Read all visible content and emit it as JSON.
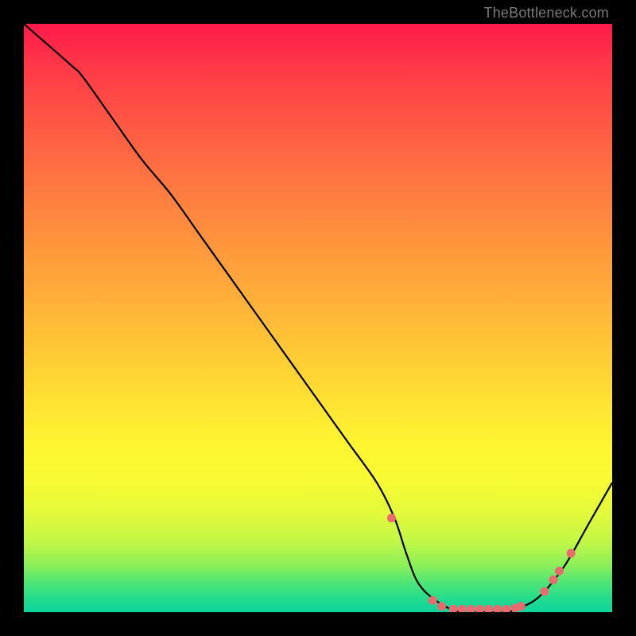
{
  "attribution": "TheBottleneck.com",
  "chart_data": {
    "type": "line",
    "title": "",
    "xlabel": "",
    "ylabel": "",
    "xlim": [
      0,
      100
    ],
    "ylim": [
      0,
      100
    ],
    "series": [
      {
        "name": "curve",
        "x": [
          0,
          8,
          10,
          15,
          20,
          25,
          30,
          35,
          40,
          45,
          50,
          55,
          60,
          63,
          65,
          67,
          70,
          74,
          78,
          82,
          85,
          88,
          92,
          96,
          100
        ],
        "values": [
          100,
          93,
          91,
          84,
          77,
          71,
          64,
          57,
          50,
          43,
          36,
          29,
          22,
          16,
          10,
          5,
          2,
          0,
          0,
          0,
          1,
          3,
          8,
          15,
          22
        ]
      }
    ],
    "markers": {
      "name": "dots",
      "points": [
        {
          "x": 62.5,
          "y": 16
        },
        {
          "x": 69.5,
          "y": 2
        },
        {
          "x": 71.0,
          "y": 1
        },
        {
          "x": 73.0,
          "y": 0.5
        },
        {
          "x": 74.5,
          "y": 0.5
        },
        {
          "x": 76.0,
          "y": 0.5
        },
        {
          "x": 77.5,
          "y": 0.5
        },
        {
          "x": 79.0,
          "y": 0.5
        },
        {
          "x": 80.5,
          "y": 0.5
        },
        {
          "x": 82.0,
          "y": 0.5
        },
        {
          "x": 83.5,
          "y": 0.7
        },
        {
          "x": 84.5,
          "y": 1.0
        },
        {
          "x": 88.5,
          "y": 3.5
        },
        {
          "x": 90.0,
          "y": 5.5
        },
        {
          "x": 91.0,
          "y": 7.0
        },
        {
          "x": 93.0,
          "y": 10.0
        }
      ]
    },
    "colors": {
      "line": "#000000",
      "marker": "#e96a6f"
    }
  }
}
